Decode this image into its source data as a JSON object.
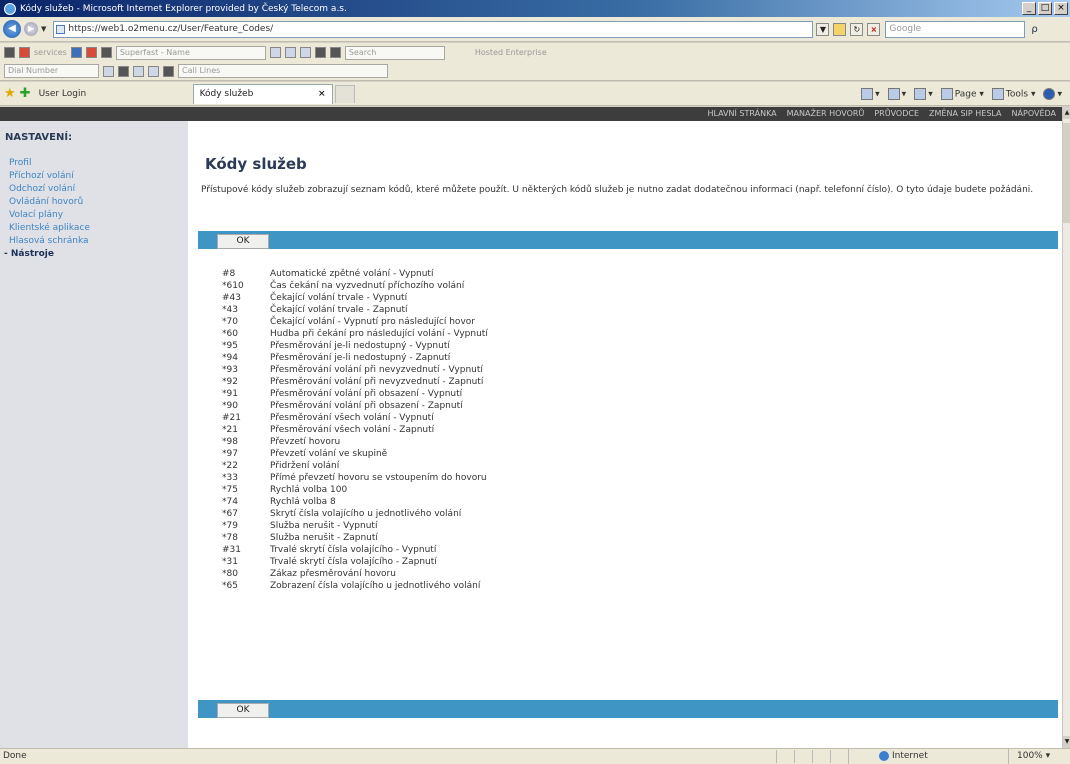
{
  "window": {
    "title": "Kódy služeb - Microsoft Internet Explorer provided by Český Telecom a.s.",
    "min": "_",
    "max": "□",
    "close": "×"
  },
  "addressbar": {
    "url": "https://web1.o2menu.cz/User/Feature_Codes/",
    "search_placeholder": "Google",
    "search_go": "ρ"
  },
  "toolbar1": {
    "label1": "services",
    "dropdown1": "Superfast - Name",
    "search": "Search",
    "label2": "Hosted Enterprise"
  },
  "toolbar2": {
    "dropdown1": "Dial Number",
    "dropdown2": "Call Lines"
  },
  "tabs": {
    "favorite_label": "User Login",
    "active_tab": "Kódy služeb",
    "close": "×",
    "cmd_page": "Page",
    "cmd_tools": "Tools"
  },
  "topnav": [
    "HLAVNÍ STRÁNKA",
    "MANAŽER HOVORŮ",
    "PRŮVODCE",
    "ZMĚNA SIP HESLA",
    "NÁPOVĚDA"
  ],
  "sidebar": {
    "heading": "NASTAVENÍ:",
    "items": [
      "Profil",
      "Příchozí volání",
      "Odchozí volání",
      "Ovládání hovorů",
      "Volací plány",
      "Klientské aplikace",
      "Hlasová schránka"
    ],
    "active": "- Nástroje"
  },
  "main": {
    "title": "Kódy služeb",
    "description": "Přístupové kódy služeb zobrazují seznam kódů, které můžete použít. U některých kódů služeb je nutno zadat dodatečnou informaci (např. telefonní číslo). O tyto údaje budete požádáni.",
    "ok_top": "OK",
    "ok_bottom": "OK"
  },
  "codes": [
    {
      "code": "#8",
      "desc": "Automatické zpětné volání - Vypnutí"
    },
    {
      "code": "*610",
      "desc": "Čas čekání na vyzvednutí příchozího volání"
    },
    {
      "code": "#43",
      "desc": "Čekající volání trvale - Vypnutí"
    },
    {
      "code": "*43",
      "desc": "Čekající volání trvale - Zapnutí"
    },
    {
      "code": "*70",
      "desc": "Čekající volání - Vypnutí pro následující hovor"
    },
    {
      "code": "*60",
      "desc": "Hudba při čekání pro následující volání - Vypnutí"
    },
    {
      "code": "*95",
      "desc": "Přesměrování je-li nedostupný - Vypnutí"
    },
    {
      "code": "*94",
      "desc": "Přesměrování je-li nedostupný - Zapnutí"
    },
    {
      "code": "*93",
      "desc": "Přesměrování volání při nevyzvednutí - Vypnutí"
    },
    {
      "code": "*92",
      "desc": "Přesměrování volání při nevyzvednutí - Zapnutí"
    },
    {
      "code": "*91",
      "desc": "Přesměrování volání při obsazení - Vypnutí"
    },
    {
      "code": "*90",
      "desc": "Přesměrování volání při obsazení - Zapnutí"
    },
    {
      "code": "#21",
      "desc": "Přesměrování všech volání - Vypnutí"
    },
    {
      "code": "*21",
      "desc": "Přesměrování všech volání - Zapnutí"
    },
    {
      "code": "*98",
      "desc": "Převzetí hovoru"
    },
    {
      "code": "*97",
      "desc": "Převzetí volání ve skupině"
    },
    {
      "code": "*22",
      "desc": "Přidržení volání"
    },
    {
      "code": "*33",
      "desc": "Přímé převzetí hovoru se vstoupením do hovoru"
    },
    {
      "code": "*75",
      "desc": "Rychlá volba 100"
    },
    {
      "code": "*74",
      "desc": "Rychlá volba 8"
    },
    {
      "code": "*67",
      "desc": "Skrytí čísla volajícího u jednotlivého volání"
    },
    {
      "code": "*79",
      "desc": "Služba nerušit - Vypnutí"
    },
    {
      "code": "*78",
      "desc": "Služba nerušit - Zapnutí"
    },
    {
      "code": "#31",
      "desc": "Trvalé skrytí čísla volajícího - Vypnutí"
    },
    {
      "code": "*31",
      "desc": "Trvalé skrytí čísla volajícího - Zapnutí"
    },
    {
      "code": "*80",
      "desc": "Zákaz přesměrování hovoru"
    },
    {
      "code": "*65",
      "desc": "Zobrazení čísla volajícího u jednotlivého volání"
    }
  ],
  "statusbar": {
    "left": "Done",
    "zone": "Internet",
    "zoom": "100%"
  },
  "colors": {
    "accent_bar": "#3f95c4",
    "sidebar_bg": "#dfe1e6",
    "link": "#3f84c4",
    "heading": "#2b3a55",
    "topnav_bg": "#3d3d3d"
  }
}
